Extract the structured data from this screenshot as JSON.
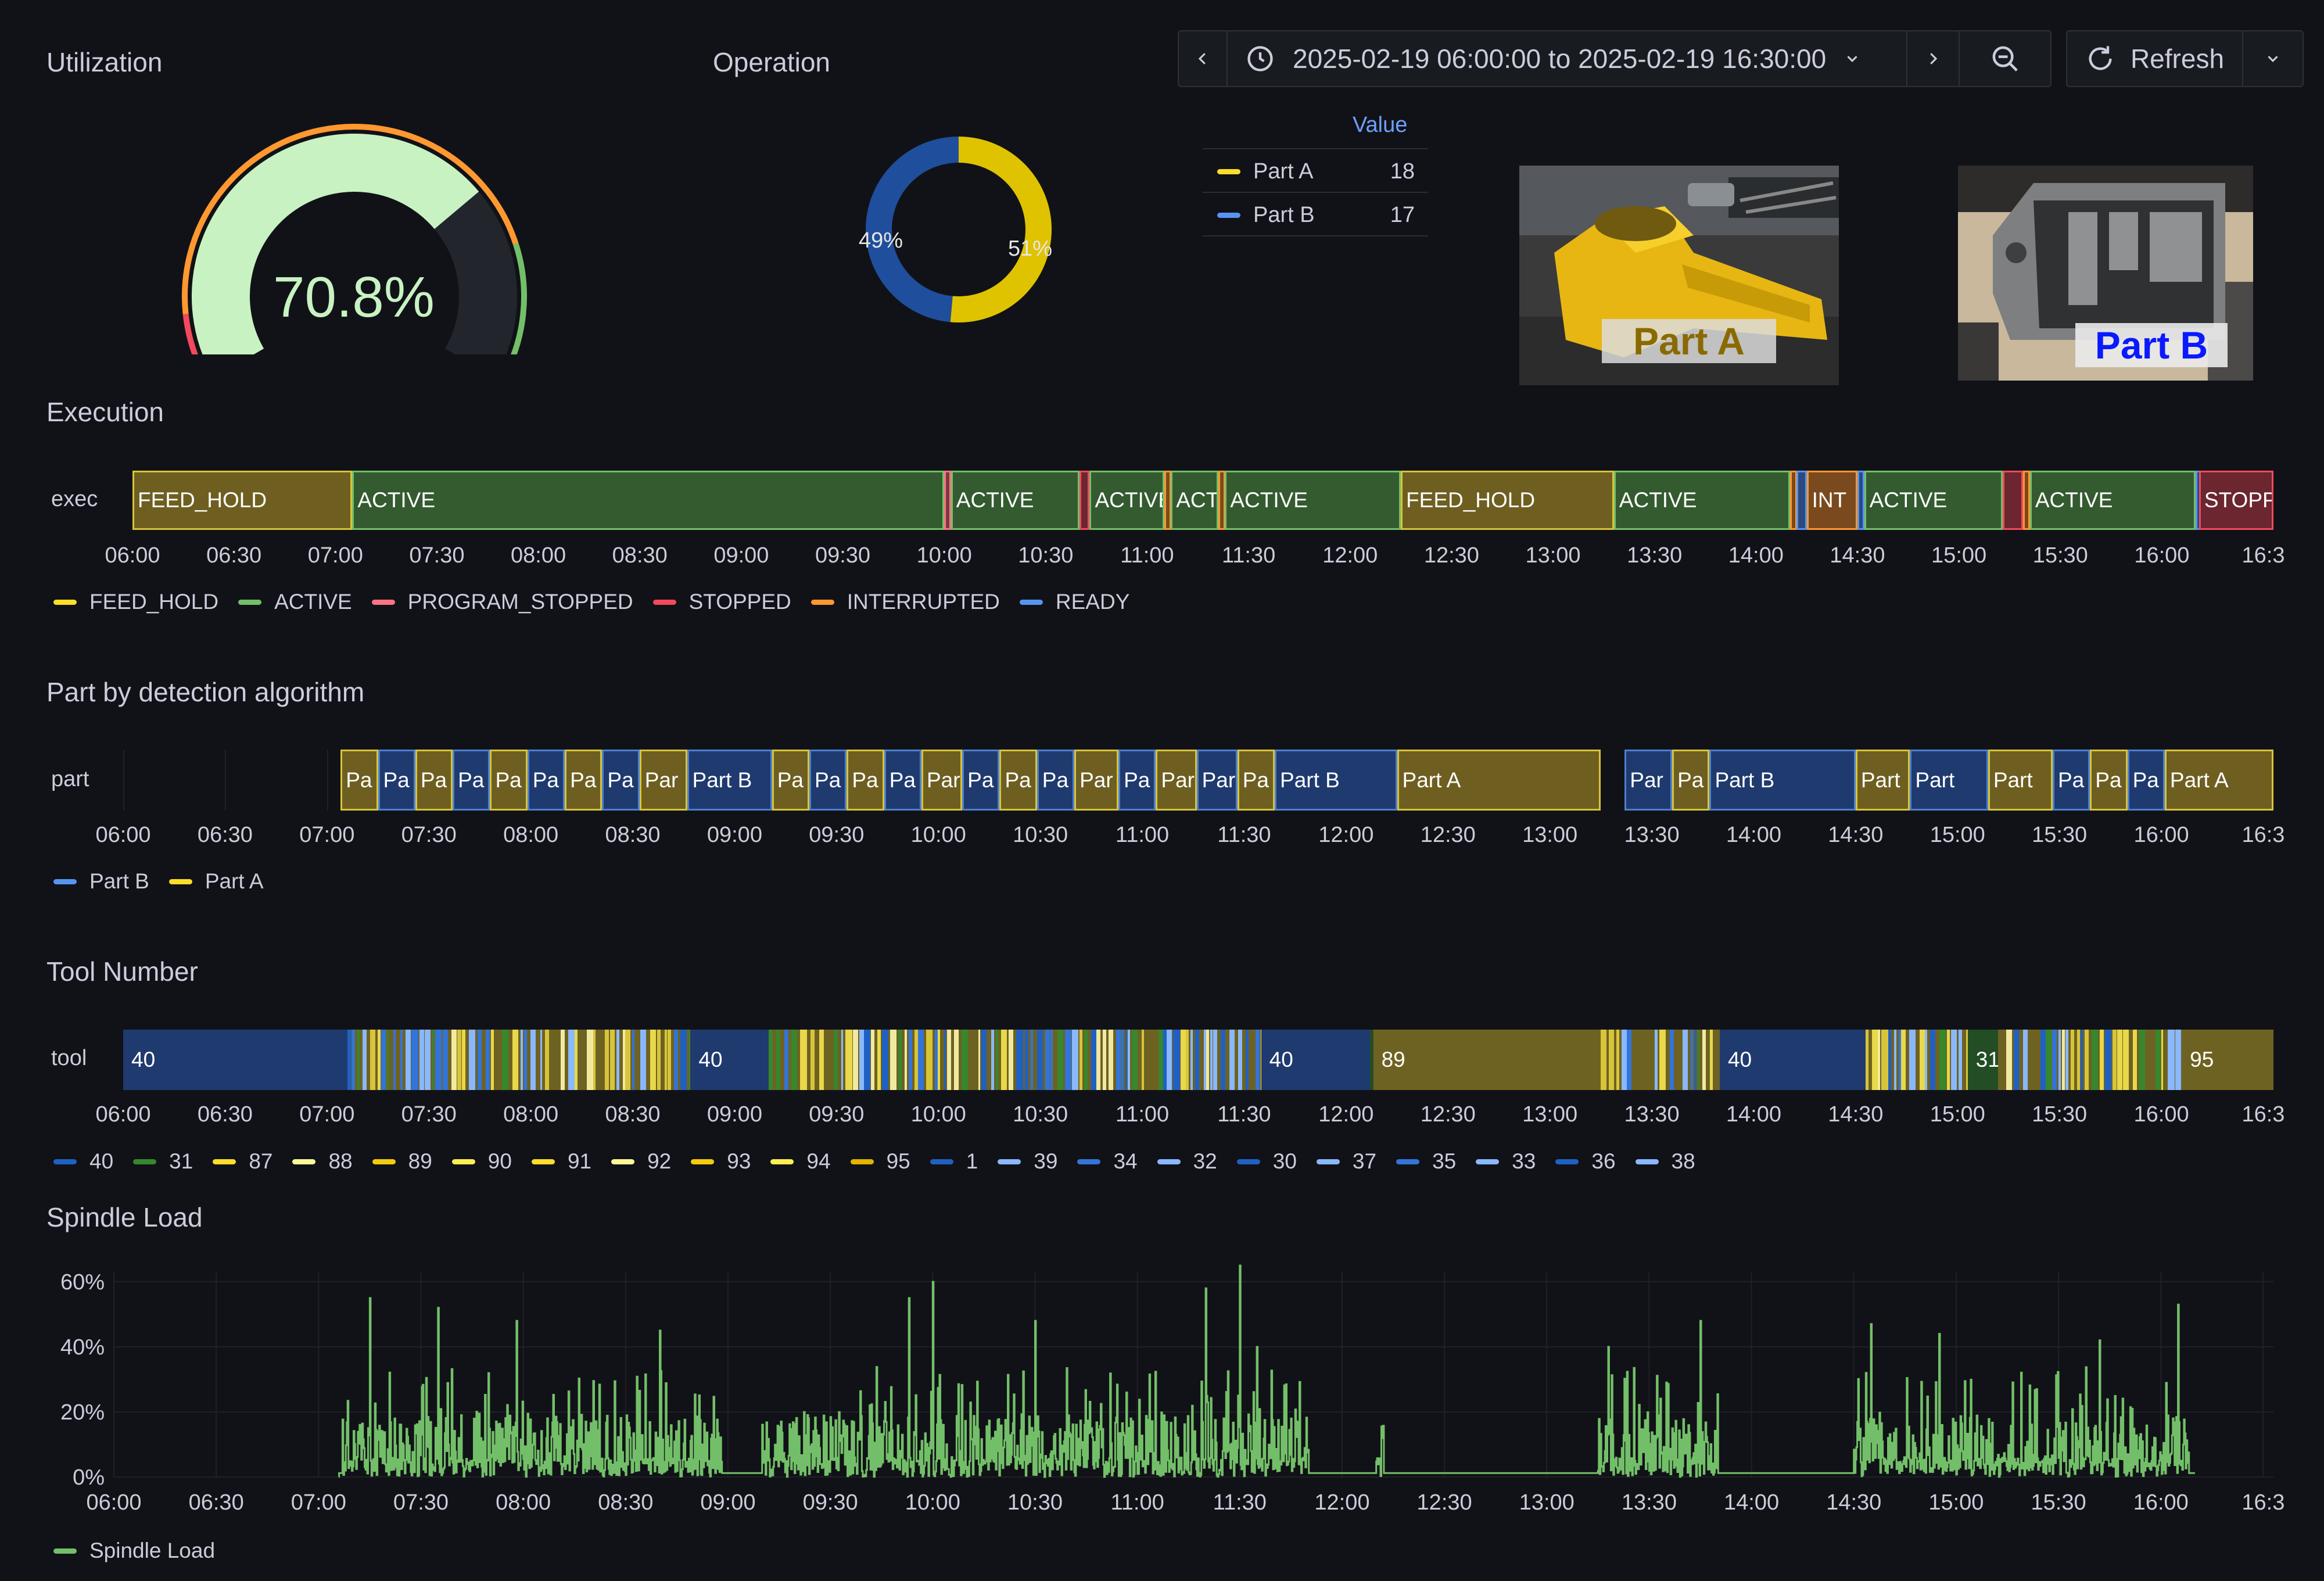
{
  "toolbar": {
    "time_range": "2025-02-19 06:00:00 to 2025-02-19 16:30:00",
    "refresh_label": "Refresh"
  },
  "utilization": {
    "title": "Utilization",
    "value_text": "70.8%",
    "value": 70.8,
    "colors": {
      "fill": "#c8f2c2",
      "track": "#22252b",
      "threshold_red": "#f2495c",
      "threshold_orange": "#ff9830",
      "threshold_green": "#73bf69"
    }
  },
  "operation": {
    "title": "Operation",
    "slices": [
      {
        "name": "Part A",
        "value": 18,
        "percent_label": "51%",
        "color": "#e0c300"
      },
      {
        "name": "Part B",
        "value": 17,
        "percent_label": "49%",
        "color": "#1f4e9c"
      }
    ],
    "legend_header": "Value",
    "legend_rows": [
      {
        "name": "Part A",
        "value": "18",
        "color": "#fade2a"
      },
      {
        "name": "Part B",
        "value": "17",
        "color": "#5794f2"
      }
    ]
  },
  "images": {
    "part_a_label": "Part A",
    "part_b_label": "Part B"
  },
  "time_ticks": [
    "06:00",
    "06:30",
    "07:00",
    "07:30",
    "08:00",
    "08:30",
    "09:00",
    "09:30",
    "10:00",
    "10:30",
    "11:00",
    "11:30",
    "12:00",
    "12:30",
    "13:00",
    "13:30",
    "14:00",
    "14:30",
    "15:00",
    "15:30",
    "16:00",
    "16:3"
  ],
  "execution": {
    "title": "Execution",
    "row_label": "exec",
    "segments": [
      {
        "start": "06:00",
        "end": "07:05",
        "state": "FEED_HOLD",
        "label": "FEED_HOLD"
      },
      {
        "start": "07:05",
        "end": "10:00",
        "state": "ACTIVE",
        "label": "ACTIVE"
      },
      {
        "start": "10:00",
        "end": "10:02",
        "state": "PROGRAM_STOPPED",
        "label": ""
      },
      {
        "start": "10:02",
        "end": "10:40",
        "state": "ACTIVE",
        "label": "ACTIVE"
      },
      {
        "start": "10:40",
        "end": "10:43",
        "state": "STOPPED",
        "label": ""
      },
      {
        "start": "10:43",
        "end": "11:05",
        "state": "ACTIVE",
        "label": "ACTIVE"
      },
      {
        "start": "11:05",
        "end": "11:07",
        "state": "INTERRUPTED",
        "label": ""
      },
      {
        "start": "11:07",
        "end": "11:21",
        "state": "ACTIVE",
        "label": "ACT"
      },
      {
        "start": "11:21",
        "end": "11:23",
        "state": "INTERRUPTED",
        "label": ""
      },
      {
        "start": "11:23",
        "end": "12:15",
        "state": "ACTIVE",
        "label": "ACTIVE"
      },
      {
        "start": "12:15",
        "end": "13:18",
        "state": "FEED_HOLD",
        "label": "FEED_HOLD"
      },
      {
        "start": "13:18",
        "end": "14:10",
        "state": "ACTIVE",
        "label": "ACTIVE"
      },
      {
        "start": "14:10",
        "end": "14:12",
        "state": "INTERRUPTED",
        "label": ""
      },
      {
        "start": "14:12",
        "end": "14:15",
        "state": "READY",
        "label": ""
      },
      {
        "start": "14:15",
        "end": "14:30",
        "state": "INTERRUPTED",
        "label": "INT"
      },
      {
        "start": "14:30",
        "end": "14:32",
        "state": "READY",
        "label": ""
      },
      {
        "start": "14:32",
        "end": "15:13",
        "state": "ACTIVE",
        "label": "ACTIVE"
      },
      {
        "start": "15:13",
        "end": "15:19",
        "state": "STOPPED",
        "label": ""
      },
      {
        "start": "15:19",
        "end": "15:21",
        "state": "INTERRUPTED",
        "label": ""
      },
      {
        "start": "15:21",
        "end": "16:10",
        "state": "ACTIVE",
        "label": "ACTIVE"
      },
      {
        "start": "16:10",
        "end": "16:11",
        "state": "READY",
        "label": ""
      },
      {
        "start": "16:11",
        "end": "16:33",
        "state": "STOPPED",
        "label": "STOPP"
      }
    ],
    "legend": [
      {
        "name": "FEED_HOLD",
        "color": "#fade2a"
      },
      {
        "name": "ACTIVE",
        "color": "#73bf69"
      },
      {
        "name": "PROGRAM_STOPPED",
        "color": "#ff7383"
      },
      {
        "name": "STOPPED",
        "color": "#f2495c"
      },
      {
        "name": "INTERRUPTED",
        "color": "#ff9830"
      },
      {
        "name": "READY",
        "color": "#5794f2"
      }
    ]
  },
  "part_detection": {
    "title": "Part by detection algorithm",
    "row_label": "part",
    "segments": [
      {
        "start": "07:04",
        "end": "07:15",
        "part": "A",
        "label": "Pa"
      },
      {
        "start": "07:15",
        "end": "07:26",
        "part": "B",
        "label": "Pa"
      },
      {
        "start": "07:26",
        "end": "07:37",
        "part": "A",
        "label": "Pa"
      },
      {
        "start": "07:37",
        "end": "07:48",
        "part": "B",
        "label": "Pa"
      },
      {
        "start": "07:48",
        "end": "07:59",
        "part": "A",
        "label": "Pa"
      },
      {
        "start": "07:59",
        "end": "08:10",
        "part": "B",
        "label": "Pa"
      },
      {
        "start": "08:10",
        "end": "08:21",
        "part": "A",
        "label": "Pa"
      },
      {
        "start": "08:21",
        "end": "08:32",
        "part": "B",
        "label": "Pa"
      },
      {
        "start": "08:32",
        "end": "08:46",
        "part": "A",
        "label": "Par"
      },
      {
        "start": "08:46",
        "end": "09:11",
        "part": "B",
        "label": "Part B"
      },
      {
        "start": "09:11",
        "end": "09:22",
        "part": "A",
        "label": "Pa"
      },
      {
        "start": "09:22",
        "end": "09:33",
        "part": "B",
        "label": "Pa"
      },
      {
        "start": "09:33",
        "end": "09:44",
        "part": "A",
        "label": "Pa"
      },
      {
        "start": "09:44",
        "end": "09:55",
        "part": "B",
        "label": "Pa"
      },
      {
        "start": "09:55",
        "end": "10:07",
        "part": "A",
        "label": "Par"
      },
      {
        "start": "10:07",
        "end": "10:18",
        "part": "B",
        "label": "Pa"
      },
      {
        "start": "10:18",
        "end": "10:29",
        "part": "A",
        "label": "Pa"
      },
      {
        "start": "10:29",
        "end": "10:40",
        "part": "B",
        "label": "Pa"
      },
      {
        "start": "10:40",
        "end": "10:53",
        "part": "A",
        "label": "Par"
      },
      {
        "start": "10:53",
        "end": "11:04",
        "part": "B",
        "label": "Pa"
      },
      {
        "start": "11:04",
        "end": "11:16",
        "part": "A",
        "label": "Par"
      },
      {
        "start": "11:16",
        "end": "11:28",
        "part": "B",
        "label": "Par"
      },
      {
        "start": "11:28",
        "end": "11:39",
        "part": "A",
        "label": "Pa"
      },
      {
        "start": "11:39",
        "end": "12:15",
        "part": "B",
        "label": "Part B"
      },
      {
        "start": "12:15",
        "end": "13:15",
        "part": "A",
        "label": "Part A"
      },
      {
        "start": "13:22",
        "end": "13:36",
        "part": "B",
        "label": "Par"
      },
      {
        "start": "13:36",
        "end": "13:47",
        "part": "A",
        "label": "Pa"
      },
      {
        "start": "13:47",
        "end": "14:30",
        "part": "B",
        "label": "Part B"
      },
      {
        "start": "14:30",
        "end": "14:46",
        "part": "A",
        "label": "Part"
      },
      {
        "start": "14:46",
        "end": "15:09",
        "part": "B",
        "label": "Part"
      },
      {
        "start": "15:09",
        "end": "15:28",
        "part": "A",
        "label": "Part"
      },
      {
        "start": "15:28",
        "end": "15:39",
        "part": "B",
        "label": "Pa"
      },
      {
        "start": "15:39",
        "end": "15:50",
        "part": "A",
        "label": "Pa"
      },
      {
        "start": "15:50",
        "end": "16:01",
        "part": "B",
        "label": "Pa"
      },
      {
        "start": "16:01",
        "end": "16:33",
        "part": "A",
        "label": "Part A"
      }
    ],
    "legend": [
      {
        "name": "Part B",
        "color": "#5794f2"
      },
      {
        "name": "Part A",
        "color": "#fade2a"
      }
    ]
  },
  "tool_number": {
    "title": "Tool Number",
    "row_label": "tool",
    "labeled_segments": [
      {
        "start": "06:00",
        "end": "07:06",
        "tool": "40",
        "label": "40"
      },
      {
        "start": "08:47",
        "end": "09:10",
        "tool": "40",
        "label": "40"
      },
      {
        "start": "11:35",
        "end": "12:07",
        "tool": "40",
        "label": "40"
      },
      {
        "start": "12:07",
        "end": "12:08",
        "tool": "31",
        "label": ""
      },
      {
        "start": "12:08",
        "end": "13:15",
        "tool": "89",
        "label": "89"
      },
      {
        "start": "13:50",
        "end": "14:33",
        "tool": "40",
        "label": "40"
      },
      {
        "start": "15:03",
        "end": "15:12",
        "tool": "31",
        "label": "31"
      },
      {
        "start": "16:06",
        "end": "16:33",
        "tool": "95",
        "label": "95"
      }
    ],
    "legend": [
      {
        "name": "40",
        "color": "#1f60c4"
      },
      {
        "name": "31",
        "color": "#37872d"
      },
      {
        "name": "87",
        "color": "#fade2a"
      },
      {
        "name": "88",
        "color": "#fff899"
      },
      {
        "name": "89",
        "color": "#f2cc0c"
      },
      {
        "name": "90",
        "color": "#ffee52"
      },
      {
        "name": "91",
        "color": "#fade2a"
      },
      {
        "name": "92",
        "color": "#fff899"
      },
      {
        "name": "93",
        "color": "#f2cc0c"
      },
      {
        "name": "94",
        "color": "#ffee52"
      },
      {
        "name": "95",
        "color": "#e0b400"
      },
      {
        "name": "1",
        "color": "#1f60c4"
      },
      {
        "name": "39",
        "color": "#8ab8ff"
      },
      {
        "name": "34",
        "color": "#3274d9"
      },
      {
        "name": "32",
        "color": "#8ab8ff"
      },
      {
        "name": "30",
        "color": "#1f60c4"
      },
      {
        "name": "37",
        "color": "#8ab8ff"
      },
      {
        "name": "35",
        "color": "#3274d9"
      },
      {
        "name": "33",
        "color": "#8ab8ff"
      },
      {
        "name": "36",
        "color": "#1f60c4"
      },
      {
        "name": "38",
        "color": "#8ab8ff"
      }
    ]
  },
  "chart_data": {
    "type": "line",
    "title": "Spindle Load",
    "series": [
      {
        "name": "Spindle Load",
        "color": "#73bf69"
      }
    ],
    "y_ticks": [
      "0%",
      "20%",
      "40%",
      "60%"
    ],
    "ylim": [
      0,
      70
    ],
    "x_range": [
      "06:00",
      "16:33"
    ],
    "grid": true,
    "legend_placement": "bottom-left",
    "active_windows": [
      [
        "07:07",
        "08:58"
      ],
      [
        "09:10",
        "11:50"
      ],
      [
        "12:10",
        "12:12"
      ],
      [
        "13:15",
        "13:50"
      ],
      [
        "14:30",
        "16:08"
      ]
    ],
    "peaks": [
      {
        "x": "07:15",
        "y": 55
      },
      {
        "x": "07:35",
        "y": 52
      },
      {
        "x": "07:58",
        "y": 48
      },
      {
        "x": "08:40",
        "y": 45
      },
      {
        "x": "09:53",
        "y": 55
      },
      {
        "x": "10:00",
        "y": 60
      },
      {
        "x": "10:30",
        "y": 48
      },
      {
        "x": "11:20",
        "y": 58
      },
      {
        "x": "11:30",
        "y": 65
      },
      {
        "x": "11:35",
        "y": 40
      },
      {
        "x": "13:18",
        "y": 40
      },
      {
        "x": "13:45",
        "y": 48
      },
      {
        "x": "14:35",
        "y": 47
      },
      {
        "x": "14:55",
        "y": 44
      },
      {
        "x": "15:42",
        "y": 42
      },
      {
        "x": "16:05",
        "y": 53
      }
    ]
  }
}
